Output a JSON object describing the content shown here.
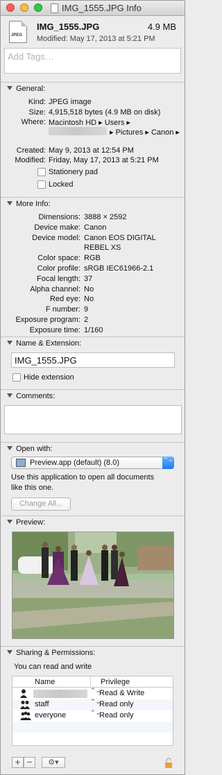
{
  "window": {
    "title": "IMG_1555.JPG Info"
  },
  "header": {
    "file_name": "IMG_1555.JPG",
    "file_size": "4.9 MB",
    "modified": "Modified: May 17, 2013 at 5:21 PM",
    "icon_label": "JPEG"
  },
  "tags": {
    "placeholder": "Add Tags…"
  },
  "general": {
    "title": "General:",
    "kind_label": "Kind:",
    "kind_value": "JPEG image",
    "size_label": "Size:",
    "size_value": "4,915,518 bytes (4.9 MB on disk)",
    "where_label": "Where:",
    "where_line1": "Macintosh HD ▸ Users ▸",
    "where_line2": "▸ Pictures ▸ Canon ▸",
    "created_label": "Created:",
    "created_value": "May 9, 2013 at 12:54 PM",
    "modified_label": "Modified:",
    "modified_value": "Friday, May 17, 2013 at 5:21 PM",
    "stationery_label": "Stationery pad",
    "locked_label": "Locked"
  },
  "more_info": {
    "title": "More Info:",
    "rows": [
      {
        "k": "Dimensions:",
        "v": "3888 × 2592"
      },
      {
        "k": "Device make:",
        "v": "Canon"
      },
      {
        "k": "Device model:",
        "v": "Canon EOS DIGITAL"
      },
      {
        "k": "",
        "v": "REBEL XS"
      },
      {
        "k": "Color space:",
        "v": "RGB"
      },
      {
        "k": "Color profile:",
        "v": "sRGB IEC61966-2.1"
      },
      {
        "k": "Focal length:",
        "v": "37"
      },
      {
        "k": "Alpha channel:",
        "v": "No"
      },
      {
        "k": "Red eye:",
        "v": "No"
      },
      {
        "k": "F number:",
        "v": "9"
      },
      {
        "k": "Exposure program:",
        "v": "2"
      },
      {
        "k": "Exposure time:",
        "v": "1/160"
      }
    ]
  },
  "name_ext": {
    "title": "Name & Extension:",
    "name_value": "IMG_1555.JPG",
    "hide_ext_label": "Hide extension"
  },
  "comments": {
    "title": "Comments:"
  },
  "open_with": {
    "title": "Open with:",
    "app": "Preview.app (default) (8.0)",
    "note_line1": "Use this application to open all documents",
    "note_line2": "like this one.",
    "change_all": "Change All..."
  },
  "preview": {
    "title": "Preview:"
  },
  "sharing": {
    "title": "Sharing & Permissions:",
    "note": "You can read and write",
    "col_name": "Name",
    "col_privilege": "Privilege",
    "rows": [
      {
        "name": "",
        "privilege": "Read & Write"
      },
      {
        "name": "staff",
        "privilege": "Read only"
      },
      {
        "name": "everyone",
        "privilege": "Read only"
      }
    ],
    "add": "+",
    "remove": "−",
    "stepper_arrows": "⌃⌄"
  },
  "colors": {
    "accent": "#1c7cf4",
    "lock": "#e8a23a"
  }
}
